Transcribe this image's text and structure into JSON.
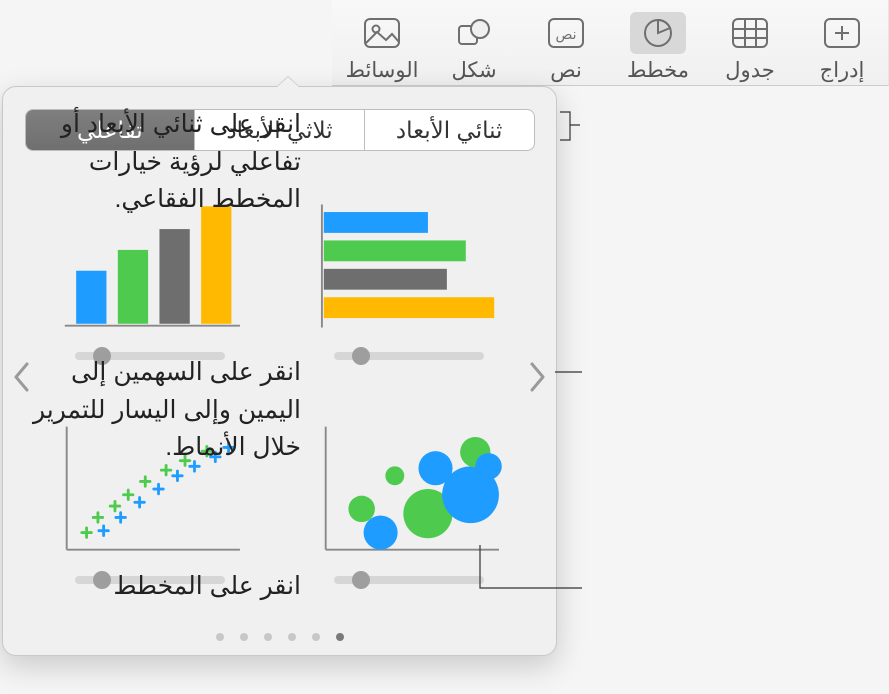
{
  "toolbar": {
    "items": [
      {
        "id": "insert",
        "label": "إدراج"
      },
      {
        "id": "table",
        "label": "جدول"
      },
      {
        "id": "chart",
        "label": "مخطط"
      },
      {
        "id": "text",
        "label": "نص"
      },
      {
        "id": "shape",
        "label": "شكل"
      },
      {
        "id": "media",
        "label": "الوسائط"
      }
    ],
    "active": "chart"
  },
  "popover": {
    "tabs": {
      "twoD": "ثنائي الأبعاد",
      "threeD": "ثلاثي الأبعاد",
      "interactive": "تفاعلي"
    },
    "active_tab": "interactive",
    "thumbs": {
      "hbar": "horizontal-bar-chart",
      "vbar": "vertical-bar-chart",
      "bubble": "bubble-chart",
      "scatter": "scatter-chart"
    },
    "page_count": 6,
    "current_page": 1
  },
  "callouts": {
    "c1": "انقر على ثنائي الأبعاد أو تفاعلي لرؤية خيارات المخطط الفقاعي.",
    "c2": "انقر على السهمين إلى اليمين وإلى اليسار للتمرير خلال الأنماط.",
    "c3": "انقر على المخطط"
  },
  "colors": {
    "blue": "#1F9CFF",
    "green": "#4ECB4E",
    "gray": "#6E6E6E",
    "amber": "#FFB900"
  }
}
